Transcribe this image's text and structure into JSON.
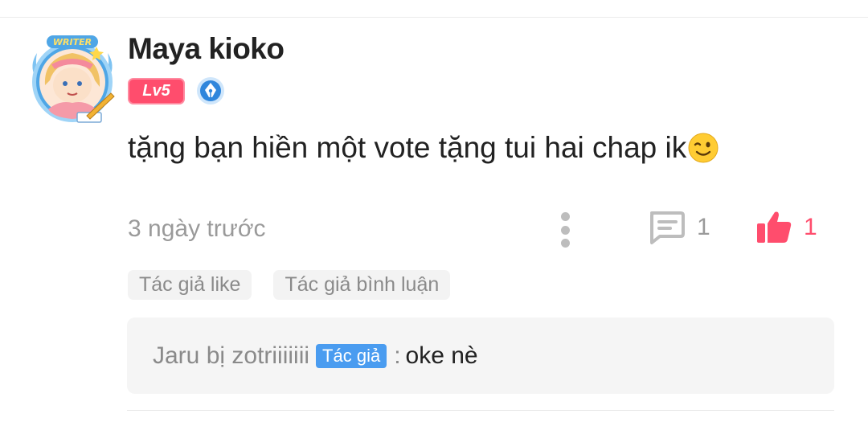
{
  "comment": {
    "author": "Maya kioko",
    "avatar_badge": "WRITER",
    "level": "Lv5",
    "text": "tặng bạn hiền một vote tặng tui hai chap ik",
    "emoji": "wink-emoji",
    "timestamp": "3 ngày trước",
    "reply_count": "1",
    "like_count": "1",
    "tags": [
      "Tác giả like",
      "Tác giả bình luận"
    ],
    "reply": {
      "author": "Jaru bị zotriiiiiii",
      "author_tag": "Tác giả",
      "separator": ":",
      "text": "oke nè"
    }
  },
  "colors": {
    "accent_pink": "#ff4d6d",
    "author_tag_blue": "#4a9cf0",
    "muted_text": "#9a9a9a"
  },
  "icons": [
    "more-icon",
    "comment-icon",
    "thumbs-up-icon",
    "pen-nib-icon"
  ]
}
